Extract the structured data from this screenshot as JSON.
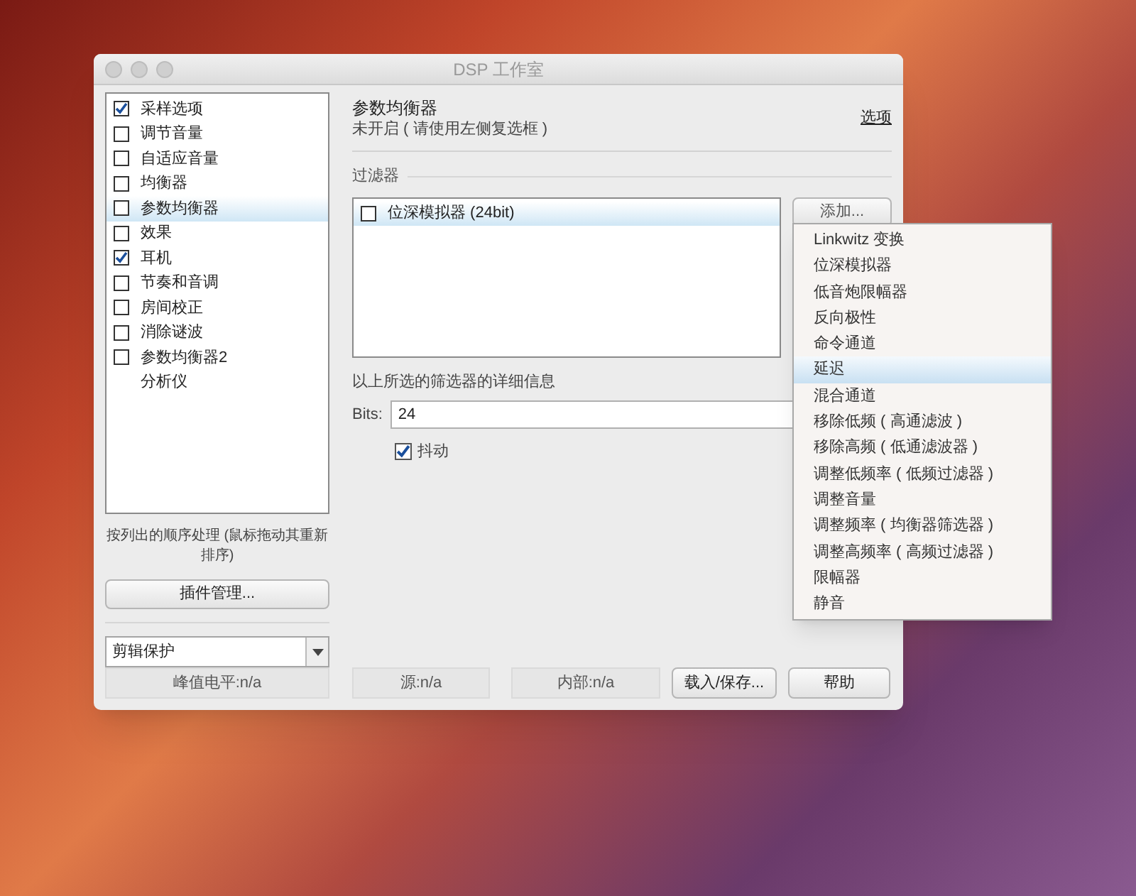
{
  "window": {
    "title": "DSP 工作室"
  },
  "sidebar": {
    "items": [
      {
        "label": "采样选项",
        "kind": "checkbox",
        "checked": true,
        "selected": false
      },
      {
        "label": "调节音量",
        "kind": "checkbox",
        "checked": false,
        "selected": false
      },
      {
        "label": "自适应音量",
        "kind": "checkbox",
        "checked": false,
        "selected": false
      },
      {
        "label": "均衡器",
        "kind": "checkbox",
        "checked": false,
        "selected": false
      },
      {
        "label": "参数均衡器",
        "kind": "checkbox",
        "checked": false,
        "selected": true
      },
      {
        "label": "效果",
        "kind": "checkbox",
        "checked": false,
        "selected": false
      },
      {
        "label": "耳机",
        "kind": "checkbox",
        "checked": true,
        "selected": false
      },
      {
        "label": "节奏和音调",
        "kind": "checkbox",
        "checked": false,
        "selected": false
      },
      {
        "label": "房间校正",
        "kind": "checkbox",
        "checked": false,
        "selected": false
      },
      {
        "label": "消除谜波",
        "kind": "checkbox",
        "checked": false,
        "selected": false
      },
      {
        "label": "参数均衡器2",
        "kind": "checkbox",
        "checked": false,
        "selected": false
      },
      {
        "label": "分析仪",
        "kind": "plain",
        "selected": false
      }
    ],
    "hint": "按列出的顺序处理 (鼠标拖动其重新排序)",
    "plugin_button": "插件管理...",
    "preset_select": {
      "value": "剪辑保护"
    }
  },
  "panel": {
    "title": "参数均衡器",
    "subtitle": "未开启 ( 请使用左侧复选框 )",
    "options_link": "选项",
    "filters_label": "过滤器",
    "filters": [
      {
        "label": "位深模拟器 (24bit)",
        "checked": false,
        "selected": true
      }
    ],
    "add_button": "添加...",
    "details_label": "以上所选的筛选器的详细信息",
    "bits": {
      "label": "Bits:",
      "value": "24"
    },
    "dither": {
      "label": "抖动",
      "checked": true
    }
  },
  "status_bar": {
    "peak": "峰值电平:n/a",
    "source": "源:n/a",
    "internal": "内部:n/a"
  },
  "buttons": [
    "载入/保存...",
    "帮助"
  ],
  "menu": {
    "items": [
      {
        "label": "Linkwitz 变换",
        "selected": false
      },
      {
        "label": "位深模拟器",
        "selected": false
      },
      {
        "label": "低音炮限幅器",
        "selected": false
      },
      {
        "label": "反向极性",
        "selected": false
      },
      {
        "label": "命令通道",
        "selected": false
      },
      {
        "label": "延迟",
        "selected": true
      },
      {
        "label": "混合通道",
        "selected": false
      },
      {
        "label": "移除低频 ( 高通滤波 )",
        "selected": false
      },
      {
        "label": "移除高频 ( 低通滤波器 )",
        "selected": false
      },
      {
        "label": "调整低频率 ( 低频过滤器 )",
        "selected": false
      },
      {
        "label": "调整音量",
        "selected": false
      },
      {
        "label": "调整频率 ( 均衡器筛选器 )",
        "selected": false
      },
      {
        "label": "调整高频率 ( 高频过滤器 )",
        "selected": false
      },
      {
        "label": "限幅器",
        "selected": false
      },
      {
        "label": "静音",
        "selected": false
      }
    ]
  }
}
